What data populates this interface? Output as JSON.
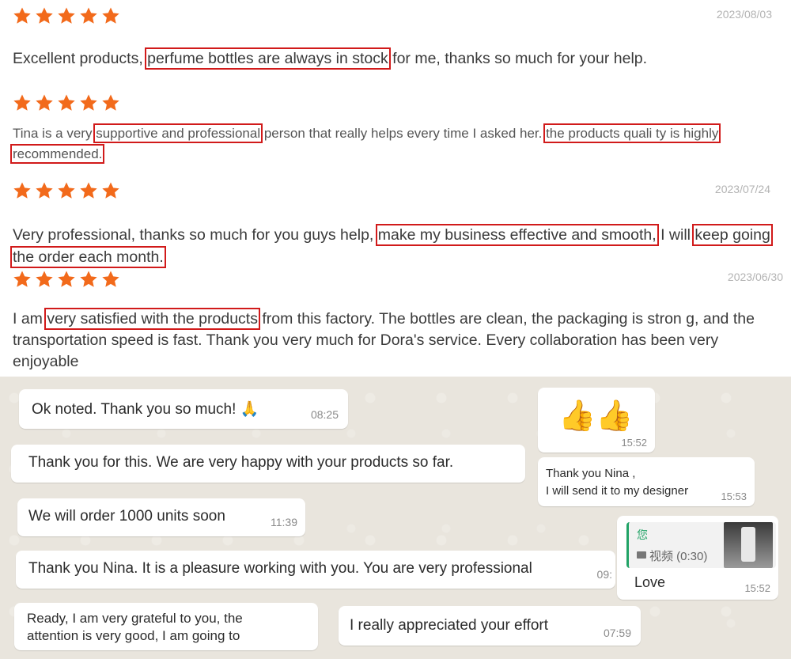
{
  "reviews": [
    {
      "date": "2023/08/03",
      "segments": [
        {
          "t": "Excellent products, ",
          "hl": false
        },
        {
          "t": "perfume bottles are always in stock",
          "hl": true
        },
        {
          "t": " for me, thanks so much for your help.",
          "hl": false
        }
      ]
    },
    {
      "date": "",
      "segments": [
        {
          "t": "Tina is a very ",
          "hl": false
        },
        {
          "t": "supportive and professional",
          "hl": true
        },
        {
          "t": " person that really helps every time I asked her. ",
          "hl": false
        },
        {
          "t": "the products quali ty is highly recommended.",
          "hl": true
        }
      ]
    },
    {
      "date": "2023/07/24",
      "segments": [
        {
          "t": "Very professional, thanks so much for you guys help, ",
          "hl": false
        },
        {
          "t": "make my business effective and smooth,",
          "hl": true
        },
        {
          "t": " I will ",
          "hl": false
        },
        {
          "t": "keep going the order each month.",
          "hl": true
        }
      ]
    },
    {
      "date": "2023/06/30",
      "segments": [
        {
          "t": "I am ",
          "hl": false
        },
        {
          "t": "very satisfied with the products",
          "hl": true
        },
        {
          "t": " from this factory. The bottles are clean, the packaging is stron g, and the transportation speed is fast. Thank you very much for Dora's service. Every collaboration has been very enjoyable",
          "hl": false
        }
      ]
    }
  ],
  "chat": {
    "messages": [
      {
        "text": "Ok noted. Thank you so much! 🙏",
        "time": "08:25"
      },
      {
        "text": "Thank you for this. We are very happy with your products so far.",
        "time": ""
      },
      {
        "text": "We will order 1000 units soon",
        "time": "11:39"
      },
      {
        "text": "Thank you Nina. It is a pleasure working with you. You are very professional",
        "time": "09:"
      },
      {
        "text": "Ready, I am very grateful to you, the attention is very good, I am going to",
        "time": ""
      },
      {
        "text": "I really appreciated your effort",
        "time": "07:59"
      },
      {
        "text": "👍👍",
        "time": "15:52"
      },
      {
        "text": "Thank you Nina ,\nI will send it to my designer",
        "time": "15:53"
      },
      {
        "quote_sender": "您",
        "quote_media": "视频 (0:30)",
        "text": "Love",
        "time": "15:52"
      }
    ]
  },
  "colors": {
    "star": "#f26a1b",
    "highlight": "#d11a1a",
    "quote_accent": "#21a366"
  }
}
